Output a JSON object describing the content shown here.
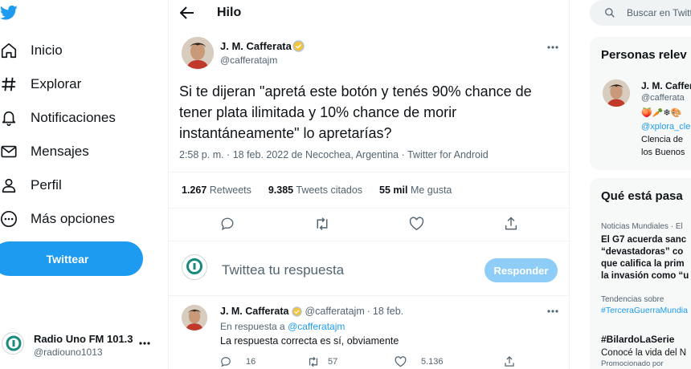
{
  "nav": {
    "items": [
      {
        "label": "Inicio",
        "icon": "home-icon"
      },
      {
        "label": "Explorar",
        "icon": "hashtag-icon"
      },
      {
        "label": "Notificaciones",
        "icon": "bell-icon"
      },
      {
        "label": "Mensajes",
        "icon": "envelope-icon"
      },
      {
        "label": "Perfil",
        "icon": "person-icon"
      },
      {
        "label": "Más opciones",
        "icon": "more-circle-icon"
      }
    ],
    "tweet_button": "Twittear",
    "account": {
      "name": "Radio Uno FM 101.3",
      "handle": "@radiouno1013"
    }
  },
  "header": {
    "title": "Hilo"
  },
  "tweet": {
    "author": "J. M. Cafferata",
    "handle": "@cafferatajm",
    "text": "Si te dijeran \"apretá este botón y tenés 90% chance de tener plata ilimitada y 10% chance de morir instantáneamente\" lo apretarías?",
    "meta": "2:58 p. m. · 18 feb. 2022 de Necochea, Argentina · Twitter for Android",
    "stats": {
      "retweets_value": "1.267",
      "retweets_label": "Retweets",
      "quotes_value": "9.385",
      "quotes_label": "Tweets citados",
      "likes_value": "55 mil",
      "likes_label": "Me gusta"
    }
  },
  "reply_box": {
    "placeholder": "Twittea tu respuesta",
    "button": "Responder"
  },
  "reply": {
    "author": "J. M. Cafferata",
    "handle": "@cafferatajm",
    "dot": "·",
    "date": "18 feb.",
    "in_reply_prefix": "En respuesta a",
    "in_reply_handle": "@cafferatajm",
    "text": "La respuesta correcta es sí, obviamente",
    "replies": "16",
    "retweets": "57",
    "likes": "5.136"
  },
  "right": {
    "search_placeholder": "Buscar en Twitter",
    "people": {
      "title": "Personas relev",
      "name": "J. M. Caffer",
      "handle": "@cafferata",
      "emojis": "🍑🥕❄🎨",
      "link": "@xplora_cle",
      "bio1": "Clencia de",
      "bio2": "los Buenos"
    },
    "trends": {
      "title": "Qué está pasa",
      "t1_context": "Noticias Mundiales · El",
      "t1_line1": "El G7 acuerda sanc",
      "t1_line2": "“devastadoras” co",
      "t1_line3": "que califica la prim",
      "t1_line4": "la invasión como “u",
      "t2_context": "Tendencias sobre",
      "t2_tag": "#TerceraGuerraMundia",
      "t3_tag": "#BilardoLaSerie",
      "t3_desc": "Conocé la vida del N",
      "t3_promo": "Promocionado por"
    }
  },
  "colors": {
    "accent": "#1d9bf0",
    "text": "#0f1419",
    "muted": "#536471",
    "border": "#eff3f4"
  }
}
